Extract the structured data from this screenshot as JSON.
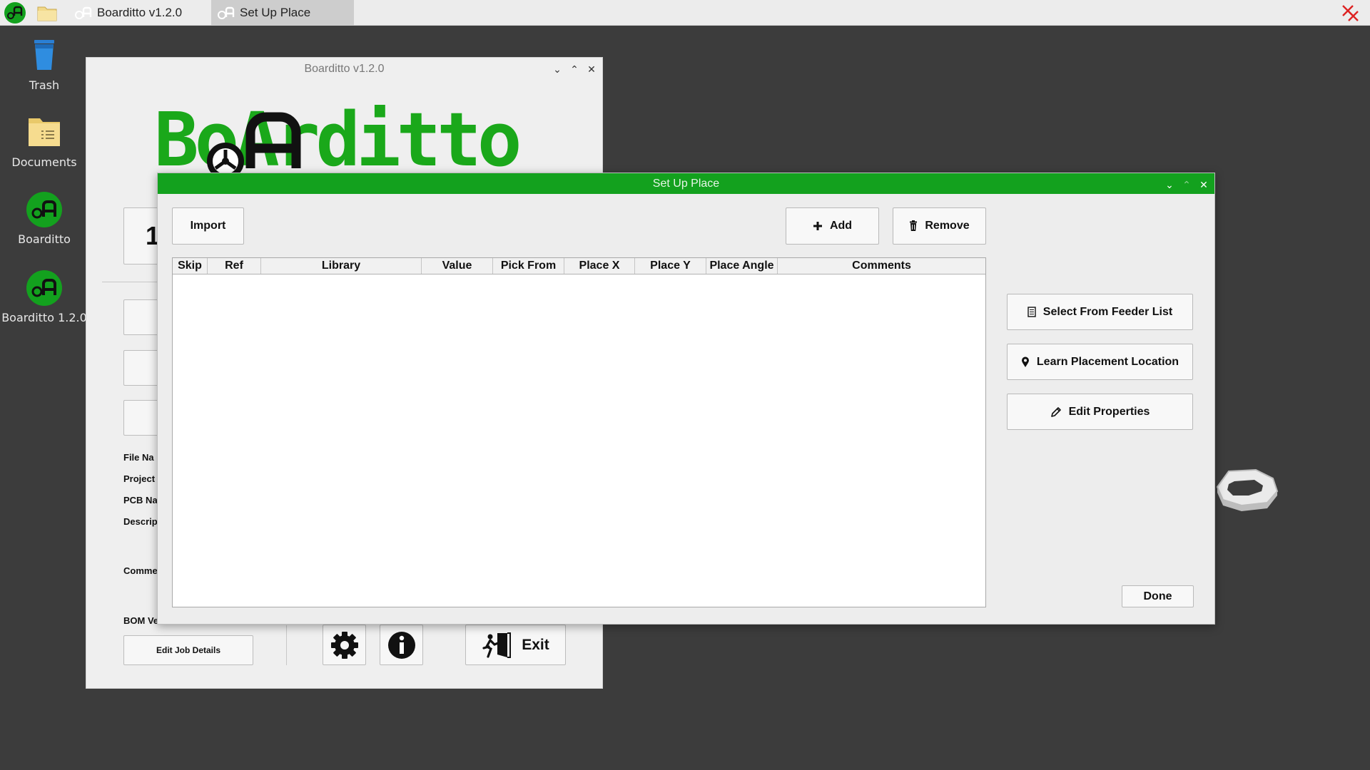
{
  "taskbar": {
    "tasks": [
      {
        "label": "Boarditto v1.2.0"
      },
      {
        "label": "Set Up Place"
      }
    ]
  },
  "desktop": {
    "icons": [
      {
        "label": "Trash"
      },
      {
        "label": "Documents"
      },
      {
        "label": "Boarditto"
      },
      {
        "label": "Boarditto 1.2.0"
      }
    ]
  },
  "main_window": {
    "title": "Boarditto v1.2.0",
    "logo_text": "BoArditto",
    "partial_number": "1",
    "info_labels": [
      "File Na",
      "Project",
      "PCB Na",
      "Descrip",
      "Comme",
      "BOM Ve"
    ],
    "edit_job_label": "Edit Job Details",
    "exit_label": "Exit"
  },
  "dialog": {
    "title": "Set Up Place",
    "import_label": "Import",
    "add_label": "Add",
    "remove_label": "Remove",
    "columns": [
      "Skip",
      "Ref",
      "Library",
      "Value",
      "Pick From",
      "Place X",
      "Place Y",
      "Place Angle",
      "Comments"
    ],
    "rows": [],
    "select_feeder_label": "Select From Feeder List",
    "learn_location_label": "Learn Placement Location",
    "edit_properties_label": "Edit Properties",
    "done_label": "Done"
  },
  "colors": {
    "accent_green": "#13a11e",
    "logo_green": "#1aa81a",
    "desktop_bg": "#3c3c3c"
  },
  "icons": [
    "app-menu-icon",
    "file-manager-icon",
    "close-all-icon",
    "trash-icon",
    "folder-icon",
    "boarditto-app-icon",
    "plus-icon",
    "trash-can-icon",
    "document-icon",
    "map-pin-icon",
    "pencil-icon",
    "gear-icon",
    "info-icon",
    "exit-door-icon"
  ]
}
